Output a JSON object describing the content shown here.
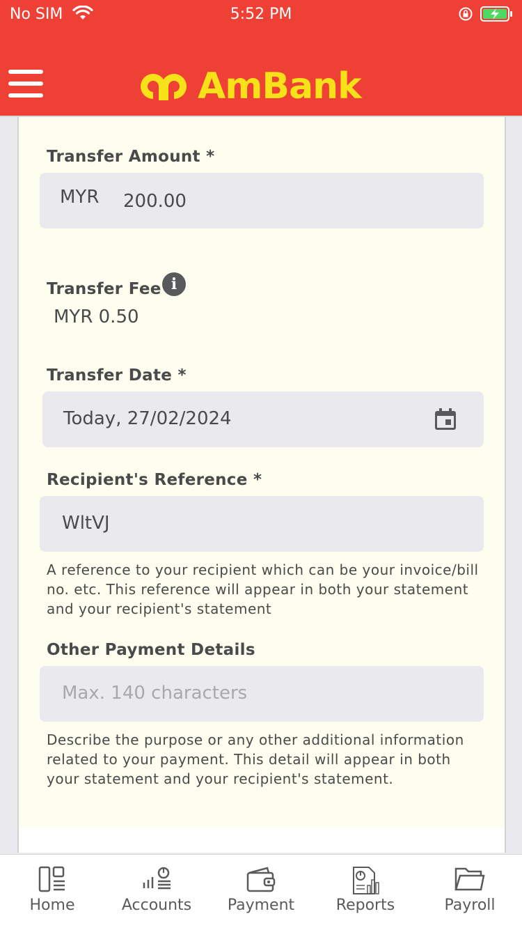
{
  "status_bar": {
    "carrier": "No SIM",
    "time": "5:52 PM"
  },
  "header": {
    "logo_text": "AmBank"
  },
  "form": {
    "transfer_amount": {
      "label": "Transfer Amount *",
      "currency": "MYR",
      "value": "200.00"
    },
    "transfer_fee": {
      "label": "Transfer Fee",
      "info_icon": "i",
      "value": "MYR 0.50"
    },
    "transfer_date": {
      "label": "Transfer Date *",
      "value": "Today, 27/02/2024"
    },
    "recipient_reference": {
      "label": "Recipient's Reference *",
      "value": "WltVJ",
      "help_line1": "A reference to your recipient which can be your invoice/bill",
      "help_line2": "no. etc. This reference will appear in both your statement",
      "help_line3": "and your recipient's statement"
    },
    "other_payment_details": {
      "label": "Other Payment Details",
      "placeholder": "Max. 140 characters",
      "help_line1": "Describe the purpose or any other additional information",
      "help_line2": "related to your payment. This detail will appear in both",
      "help_line3": "your statement and your recipient's statement."
    }
  },
  "tabbar": {
    "items": [
      {
        "label": "Home",
        "icon": "home-icon"
      },
      {
        "label": "Accounts",
        "icon": "accounts-icon"
      },
      {
        "label": "Payment",
        "icon": "wallet-icon"
      },
      {
        "label": "Reports",
        "icon": "reports-icon"
      },
      {
        "label": "Payroll",
        "icon": "folder-icon"
      }
    ]
  },
  "colors": {
    "brand_red": "#ee4034",
    "logo_yellow": "#f7e21a",
    "card_background": "#fdfdf0",
    "field_background": "#e9e9ee"
  }
}
